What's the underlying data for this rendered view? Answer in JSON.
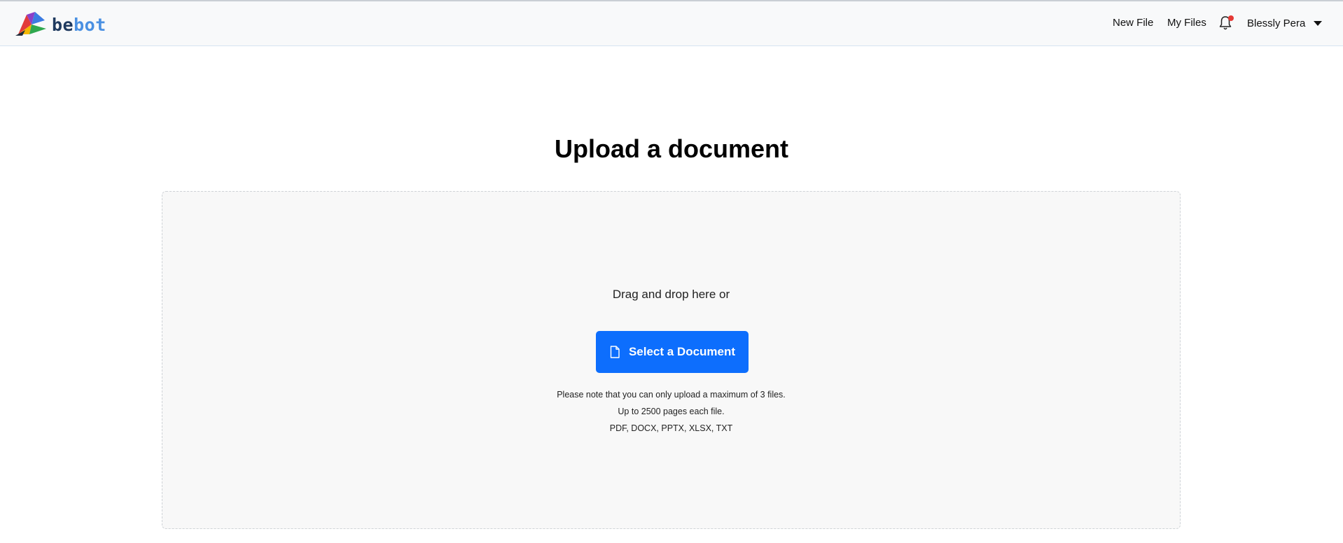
{
  "brand": {
    "part1": "be",
    "part2": "bot",
    "logo_icon": "bebot-logo-icon"
  },
  "nav": {
    "new_file": "New File",
    "my_files": "My Files",
    "notification_icon": "bell-icon",
    "user_name": "Blessly Pera",
    "user_menu_icon": "chevron-down-icon"
  },
  "main": {
    "title": "Upload a document",
    "drop_text": "Drag and drop here or",
    "select_button": "Select a Document",
    "select_icon": "file-icon",
    "notes": [
      "Please note that you can only upload a maximum of 3 files.",
      "Up to 2500 pages each file.",
      "PDF, DOCX, PPTX, XLSX, TXT"
    ]
  },
  "colors": {
    "primary": "#0d6efd",
    "navbar_bg": "#f8f9fa",
    "dropzone_bg": "#f8f8f8",
    "notification_dot": "#e53935",
    "brand_dark": "#1f3a5f",
    "brand_light": "#4a90e2"
  }
}
